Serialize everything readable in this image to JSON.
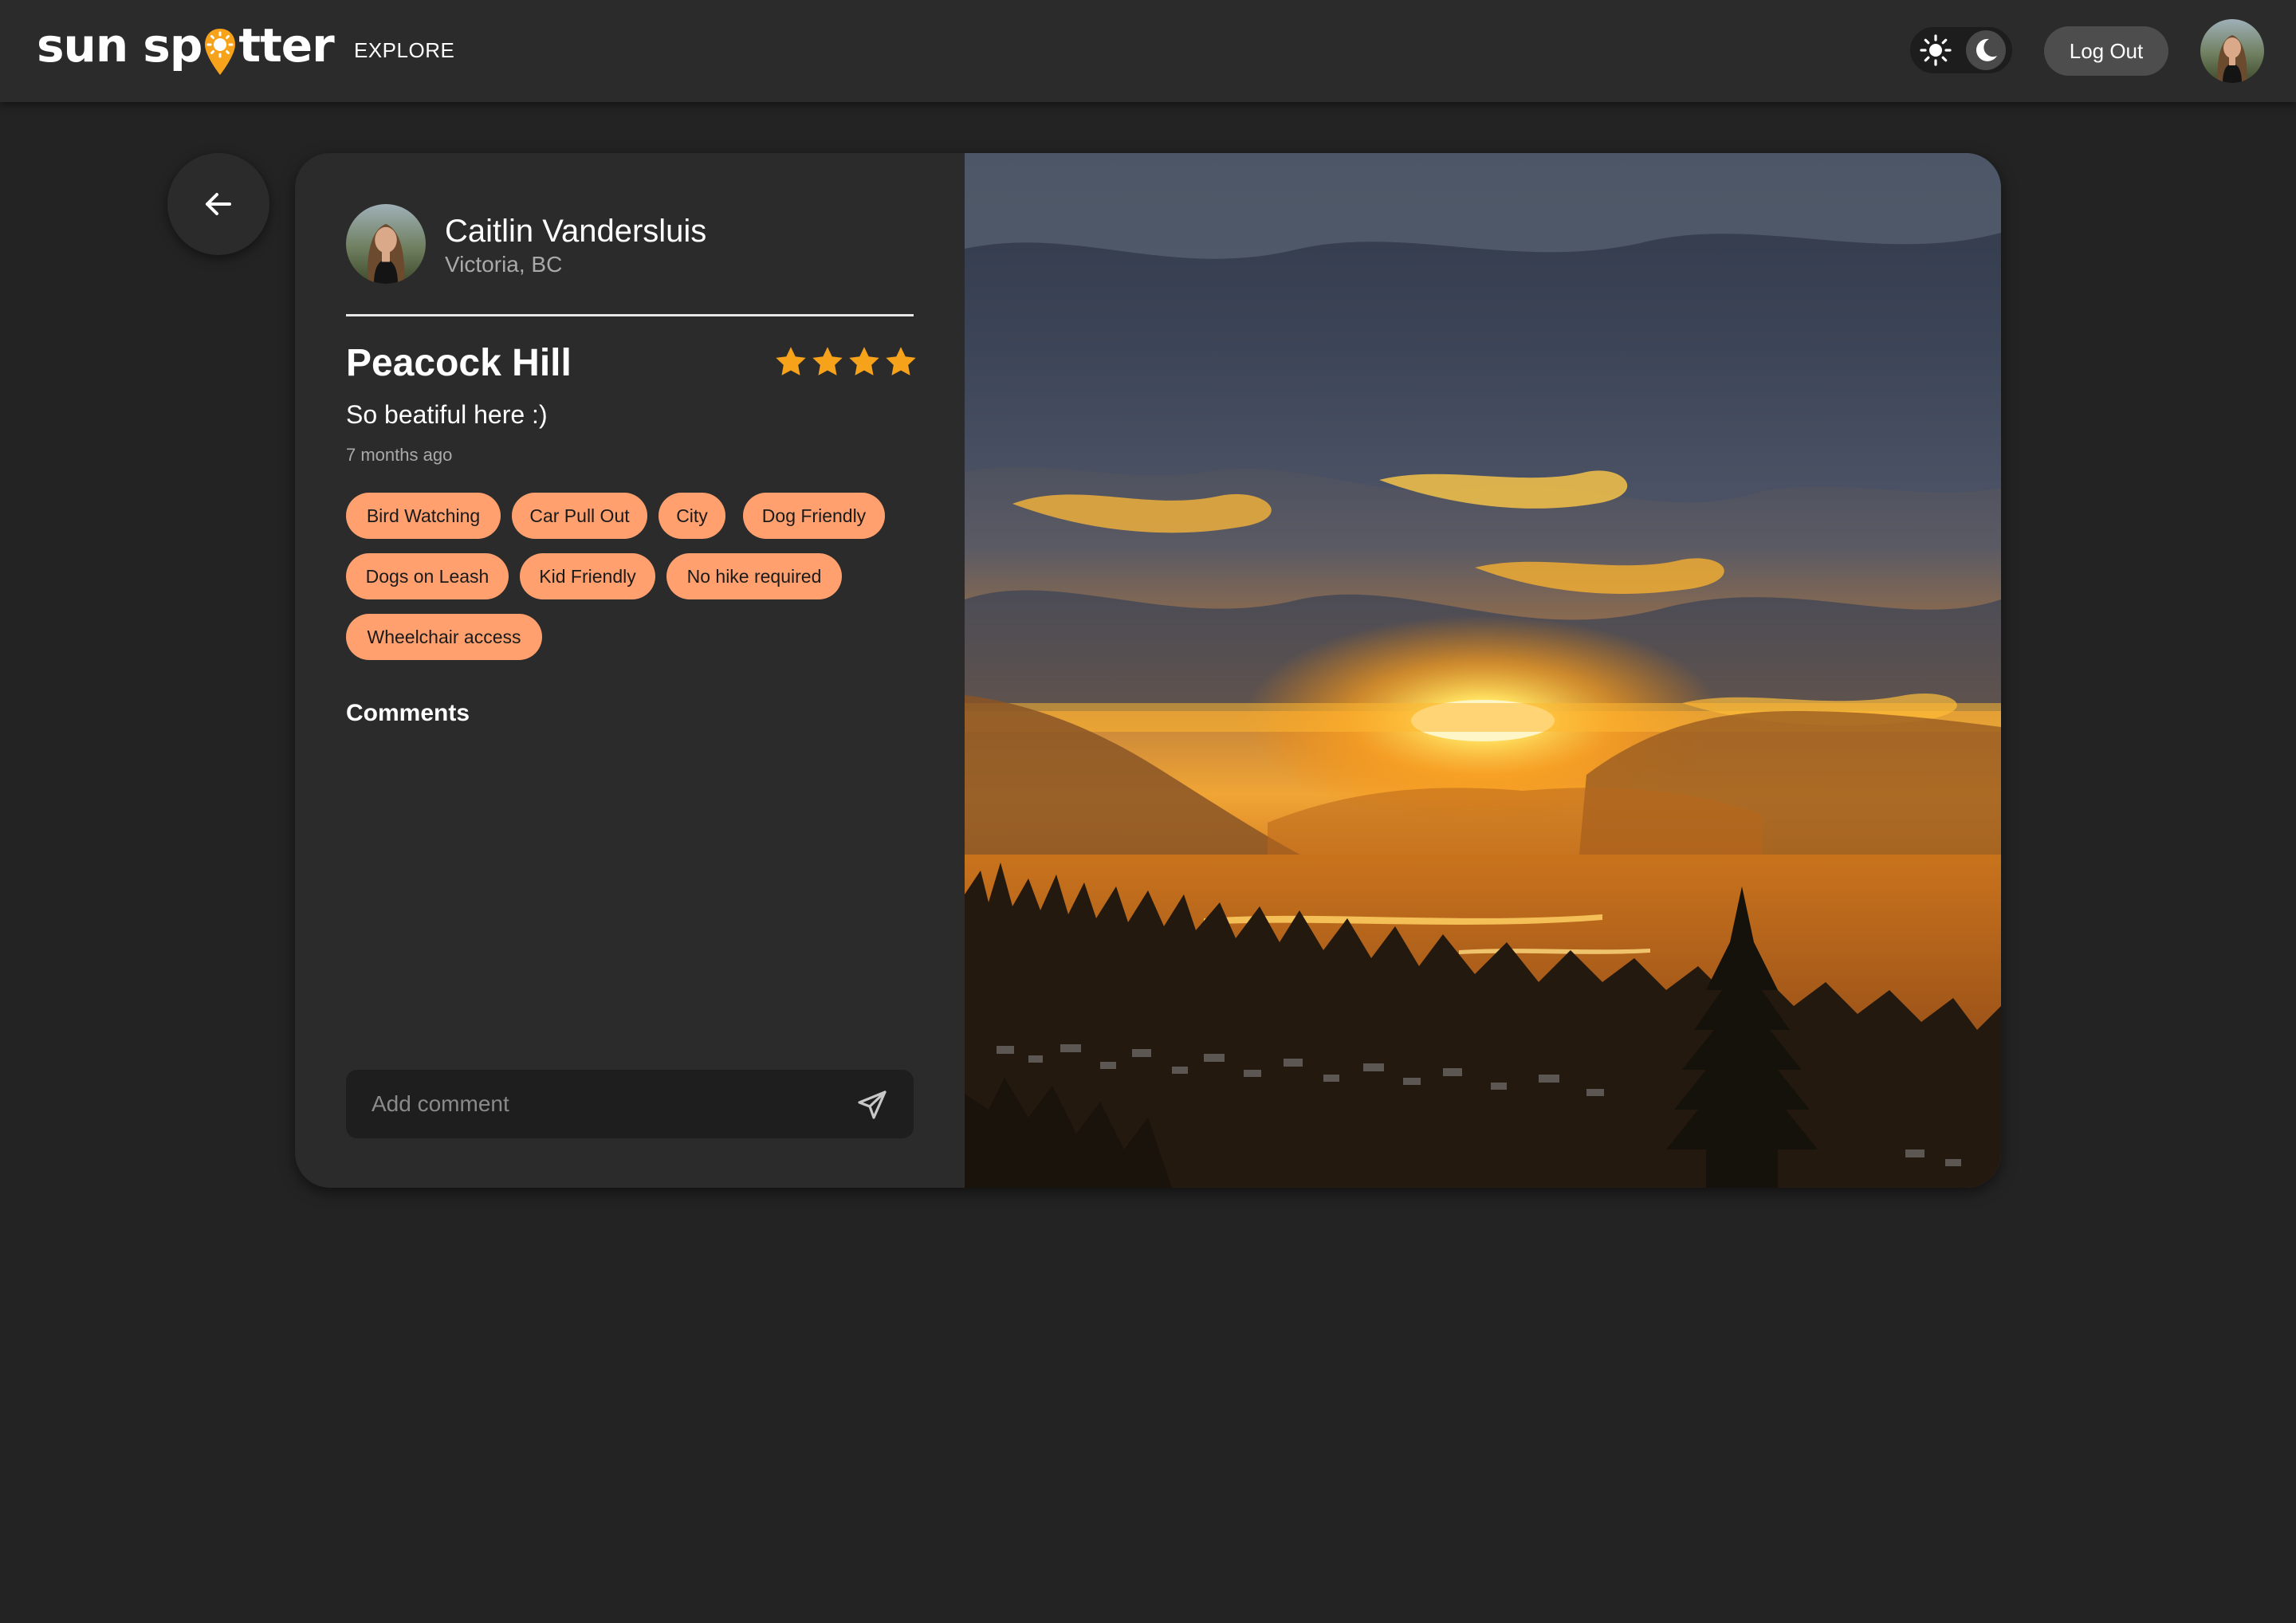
{
  "header": {
    "logo": {
      "part1": "sun sp",
      "part2": "tter"
    },
    "nav_explore": "EXPLORE",
    "theme_toggle": {
      "light_icon": "sun-icon",
      "dark_icon": "moon-icon",
      "active": "dark"
    },
    "logout_label": "Log Out",
    "avatar_icon": "user-avatar"
  },
  "back_button": {
    "icon": "arrow-left-icon"
  },
  "post": {
    "user": {
      "name": "Caitlin Vandersluis",
      "location": "Victoria, BC"
    },
    "title": "Peacock Hill",
    "rating": 4,
    "description": "So beatiful here :)",
    "time_ago": "7 months ago",
    "tags": [
      "Bird Watching",
      "Car Pull Out",
      "City",
      "Dog Friendly",
      "Dogs on Leash",
      "Kid Friendly",
      "No hike required",
      "Wheelchair access"
    ],
    "comments_heading": "Comments",
    "comment_placeholder": "Add comment",
    "send_icon": "send-icon",
    "photo": "sunset-over-valley-photo"
  },
  "colors": {
    "background": "#232323",
    "header": "#2b2b2b",
    "card": "#2b2b2b",
    "tag": "#ffa06e",
    "star": "#f7a21b",
    "logo_pin": "#f7a21b"
  }
}
